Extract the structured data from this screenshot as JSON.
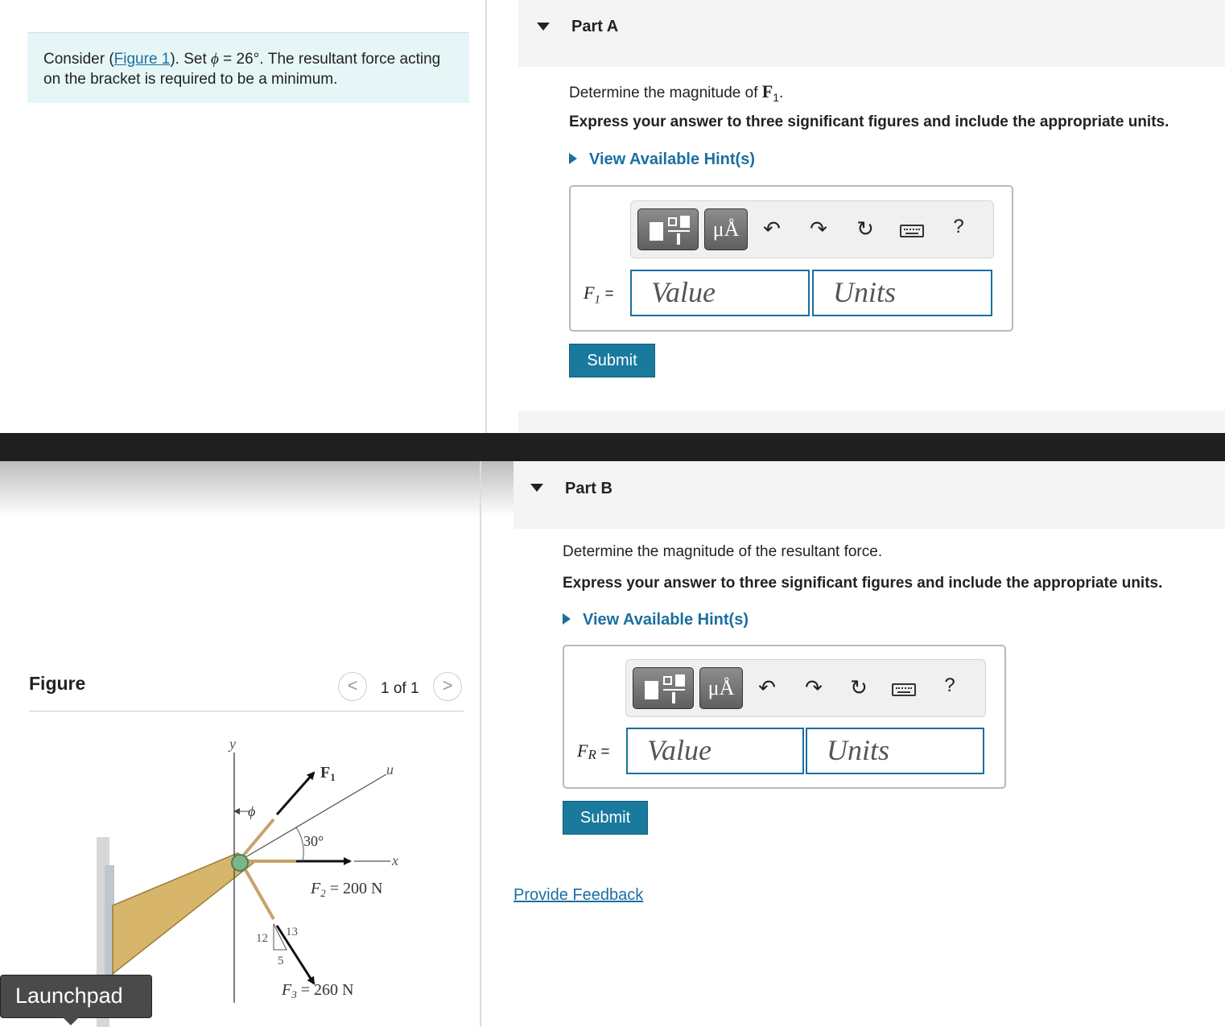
{
  "problem": {
    "prefix": "Consider (",
    "figure_link": "Figure 1",
    "mid": "). Set ",
    "phi": "ϕ",
    "suffix": " = 26°. The resultant force acting on the bracket is required to be a minimum."
  },
  "partA": {
    "title": "Part A",
    "question_prefix": "Determine the magnitude of ",
    "question_var": "F",
    "question_sub": "1",
    "question_suffix": ".",
    "instruction": "Express your answer to three significant figures and include the appropriate units.",
    "hint": "View Available Hint(s)",
    "var_main": "F",
    "var_sub": "1",
    "equals": "=",
    "value_placeholder": "Value",
    "units_placeholder": "Units",
    "submit": "Submit"
  },
  "partB": {
    "title": "Part B",
    "question": "Determine the magnitude of the resultant force.",
    "instruction": "Express your answer to three significant figures and include the appropriate units.",
    "hint": "View Available Hint(s)",
    "var_main": "F",
    "var_sub": "R",
    "equals": "=",
    "value_placeholder": "Value",
    "units_placeholder": "Units",
    "submit": "Submit"
  },
  "toolbar": {
    "units_btn": "μÅ",
    "help": "?",
    "icons": [
      "templates-icon",
      "units-icon",
      "undo-icon",
      "redo-icon",
      "reset-icon",
      "keyboard-icon",
      "help-icon"
    ]
  },
  "figure": {
    "title": "Figure",
    "pager": "1 of 1",
    "prev": "<",
    "next": ">",
    "labels": {
      "y": "y",
      "u": "u",
      "x": "x",
      "phi": "ϕ",
      "f1": "F",
      "f1_sub": "1",
      "angle": "30°",
      "f2": "F",
      "f2_sub": "2",
      "f2_value": " = 200 N",
      "f3": "F",
      "f3_sub": "3",
      "f3_value": " = 260 N",
      "slope_12": "12",
      "slope_13": "13",
      "slope_5": "5"
    }
  },
  "feedback": "Provide Feedback",
  "launchpad": "Launchpad",
  "colors": {
    "accent": "#1a6fa0",
    "submit_bg": "#1a7a9e",
    "problem_bg": "#e6f6f7",
    "part_header_bg": "#f4f4f4",
    "separator": "#1f1f1f"
  }
}
